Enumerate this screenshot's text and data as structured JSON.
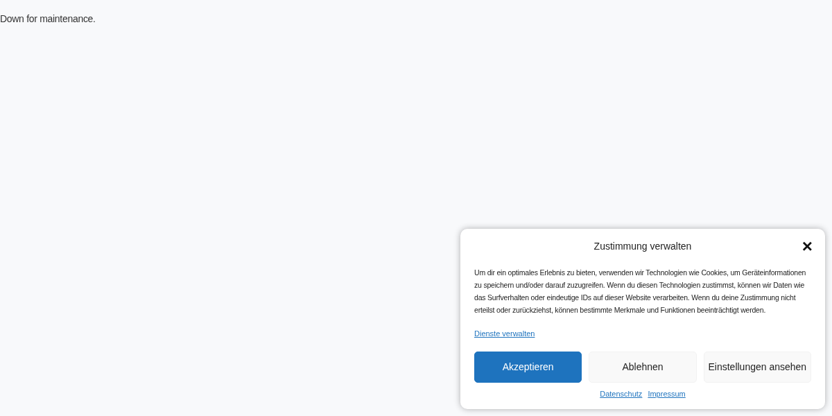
{
  "page": {
    "message": "Down for maintenance."
  },
  "consent_banner": {
    "title": "Zustimmung verwalten",
    "close": "×",
    "text": "Um dir ein optimales Erlebnis zu bieten, verwenden wir Technologien wie Cookies, um Geräteinformationen zu speichern und/oder darauf zuzugreifen. Wenn du diesen Technologien zustimmst, können wir Daten wie das Surfverhalten oder eindeutige IDs auf dieser Website verarbeiten. Wenn du deine Zustimmung nicht erteilst oder zurückziehst, können bestimmte Merkmale und Funktionen beeinträchtigt werden.",
    "manage_link": "Dienste verwalten",
    "buttons": [
      {
        "label": "Akzeptieren",
        "kind": "primary"
      },
      {
        "label": "Ablehnen",
        "kind": "secondary"
      },
      {
        "label": "Einstellungen ansehen",
        "kind": "secondary"
      }
    ],
    "footer_links": [
      "Datenschutz",
      "Impressum"
    ]
  }
}
